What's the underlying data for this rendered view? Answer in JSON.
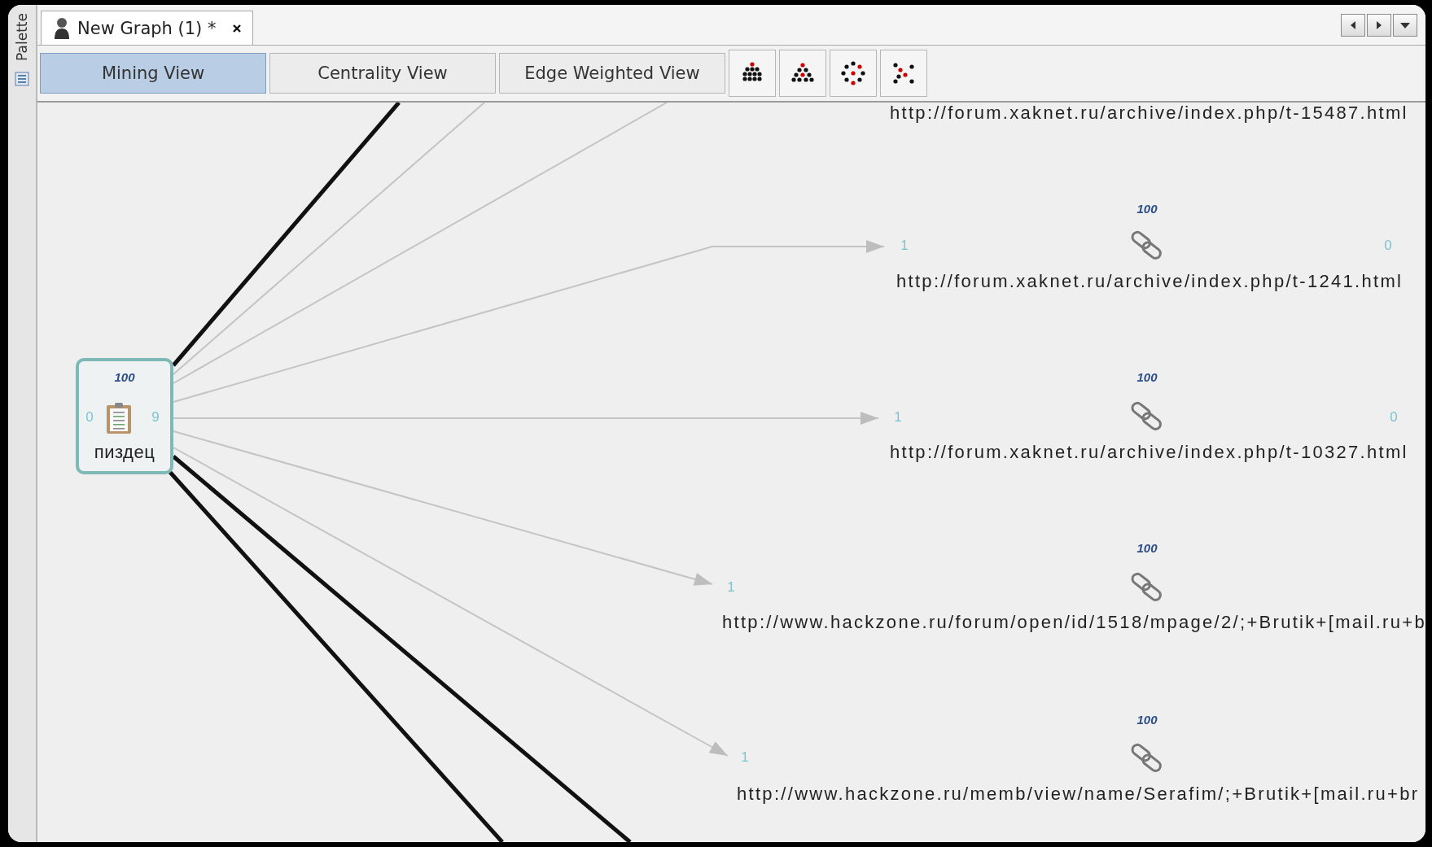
{
  "palette": {
    "label": "Palette"
  },
  "tabs": [
    {
      "title": "New Graph (1) *",
      "selected": true
    }
  ],
  "views": [
    {
      "label": "Mining View",
      "selected": true
    },
    {
      "label": "Centrality View",
      "selected": false
    },
    {
      "label": "Edge Weighted View",
      "selected": false
    }
  ],
  "graph": {
    "source": {
      "weight": "100",
      "incoming": "0",
      "outgoing": "9",
      "label": "пиздец",
      "selected": true
    },
    "targets": [
      {
        "label": "http://forum.xaknet.ru/archive/index.php/t-15487.html"
      },
      {
        "weight": "100",
        "incoming": "1",
        "outgoing": "0",
        "label": "http://forum.xaknet.ru/archive/index.php/t-1241.html"
      },
      {
        "weight": "100",
        "incoming": "1",
        "outgoing": "0",
        "label": "http://forum.xaknet.ru/archive/index.php/t-10327.html"
      },
      {
        "weight": "100",
        "incoming": "1",
        "label": "http://www.hackzone.ru/forum/open/id/1518/mpage/2/;+Brutik+[mail.ru+b"
      },
      {
        "weight": "100",
        "incoming": "1",
        "label": "http://www.hackzone.ru/memb/view/name/Serafim/;+Brutik+[mail.ru+br"
      }
    ]
  }
}
